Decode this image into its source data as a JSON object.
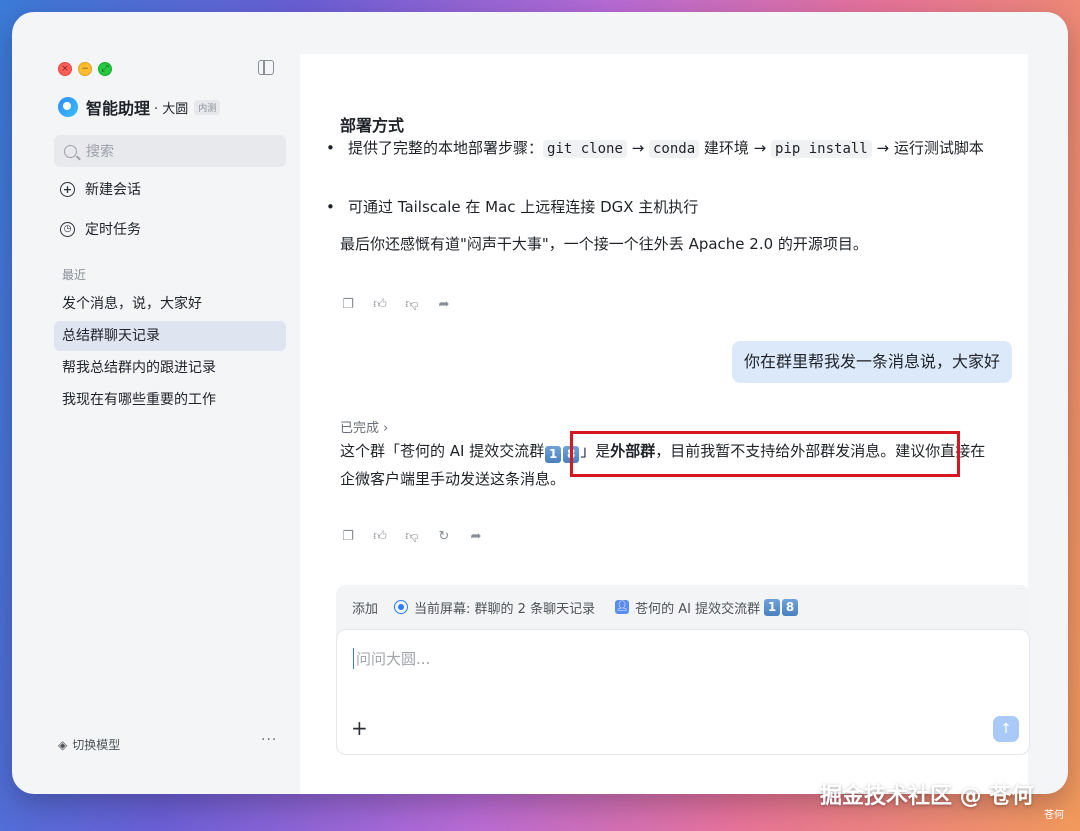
{
  "window": {
    "controls": {
      "close": "×",
      "minimize": "−",
      "zoom": "⤢"
    }
  },
  "brand": {
    "name": "智能助理",
    "subtitle": "· 大圆",
    "badge": "内测"
  },
  "search": {
    "label": "搜索"
  },
  "nav": [
    {
      "label": "新建会话",
      "icon": "plus-circle-icon"
    },
    {
      "label": "定时任务",
      "icon": "clock-icon"
    }
  ],
  "recent": {
    "label": "最近",
    "items": [
      "发个消息，说，大家好",
      "总结群聊天记录",
      "帮我总结群内的跟进记录",
      "我现在有哪些重要的工作"
    ],
    "active_index": 1
  },
  "footer": {
    "switch_model": "切换模型",
    "more": "···"
  },
  "chat": {
    "heading": "部署方式",
    "bullet1": {
      "t1": "提供了完整的本地部署步骤：",
      "c1": "git clone",
      "t2": " → ",
      "c2": "conda",
      "t3": " 建环境 → ",
      "c3": "pip install",
      "t4": " → 运行测试脚本"
    },
    "bullet2": "可通过 Tailscale 在 Mac 上远程连接 DGX 主机执行",
    "closing": "最后你还感慨有道\"闷声干大事\"，一个接一个往外丢 Apache 2.0 的开源项目。",
    "user_message": "你在群里帮我发一条消息说，大家好",
    "status": "已完成 ›",
    "answer": {
      "p1": "这个群「苍何的 AI 提效交流群",
      "k1": "1",
      "k2": "8",
      "p2": "」是",
      "bold": "外部群",
      "p3": "，目前我暂不支持给外部群发消息。建议你直接在企微客户端里手动发送这条消息。"
    }
  },
  "input": {
    "add_label": "添加",
    "ctx_screen": "当前屏幕: 群聊的 2 条聊天记录",
    "ctx_group": "苍何的 AI 提效交流群",
    "ctx_k1": "1",
    "ctx_k2": "8",
    "placeholder": "问问大圆...",
    "plus": "+",
    "send": "↑"
  },
  "watermark": {
    "main": "掘金技术社区 @ 苍何",
    "small": "苍何"
  },
  "colors": {
    "accent": "#2f7cf6",
    "user_bubble": "#dbe9fb",
    "highlight": "#d6171f"
  }
}
